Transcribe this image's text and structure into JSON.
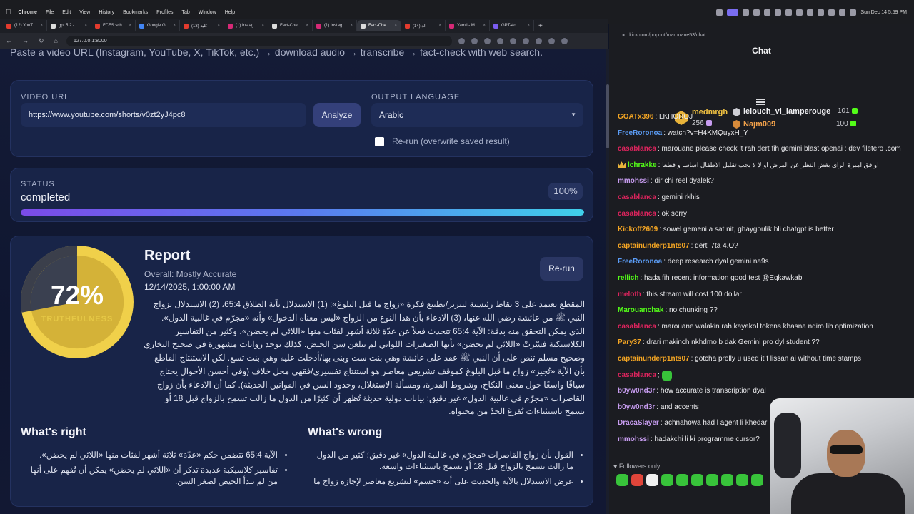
{
  "menubar": {
    "app": "Chrome",
    "items": [
      "File",
      "Edit",
      "View",
      "History",
      "Bookmarks",
      "Profiles",
      "Tab",
      "Window",
      "Help"
    ],
    "clock": "Sun Dec 14  5:59 PM"
  },
  "tabs": [
    {
      "title": "(12) YouT",
      "color": "#e33b2e",
      "active": false
    },
    {
      "title": "gpt 5.2 -",
      "color": "#dcdcdc",
      "active": false
    },
    {
      "title": "FCFS sch",
      "color": "#e33b2e",
      "active": false
    },
    {
      "title": "Google G",
      "color": "#4285f4",
      "active": false
    },
    {
      "title": "(13) كلية",
      "color": "#e33b2e",
      "active": false
    },
    {
      "title": "(1) Instag",
      "color": "#d62976",
      "active": false
    },
    {
      "title": "Fact-Che",
      "color": "#dcdcdc",
      "active": false
    },
    {
      "title": "(1) Instag",
      "color": "#d62976",
      "active": false
    },
    {
      "title": "Fact-Che",
      "color": "#dcdcdc",
      "active": true
    },
    {
      "title": "(14) الد",
      "color": "#e33b2e",
      "active": false
    },
    {
      "title": "Yamil - M",
      "color": "#d62976",
      "active": false
    },
    {
      "title": "GPT-4o",
      "color": "#7b5cf0",
      "active": false
    }
  ],
  "address": {
    "url": "127.0.0.1:8000"
  },
  "app": {
    "subtitle": "Paste a video URL (Instagram, YouTube, X, TikTok, etc.) → download audio → transcribe → fact-check with web search.",
    "video_url_label": "VIDEO URL",
    "video_url_value": "https://www.youtube.com/shorts/v0zt2yJ4pc8",
    "analyze_label": "Analyze",
    "output_language_label": "OUTPUT LANGUAGE",
    "output_language_value": "Arabic",
    "rerun_checkbox_label": "Re-run (overwrite saved result)",
    "status_label": "STATUS",
    "status_value": "completed",
    "progress_text": "100%",
    "progress": 1.0,
    "gauge_text": "72%",
    "gauge_value": 0.72,
    "gauge_sub": "TRUTHFULNESS",
    "report_title": "Report",
    "overall": "Overall: Mostly Accurate",
    "report_date": "12/14/2025, 1:00:00 AM",
    "rerun_button": "Re-run",
    "summary": "المقطع يعتمد على 3 نقاط رئيسية لتبرير/تطبيع فكرة «زواج ما قبل البلوغ»: (1) الاستدلال بآية الطلاق 65:4، (2) الاستدلال بزواج النبي ﷺ من عائشة رضي الله عنها، (3) الادعاء بأن هذا النوع من الزواج «ليس معناه الدخول» وأنه «مجرّم في غالبية الدول». الذي يمكن التحقق منه بدقة: الآية 65:4 تتحدث فعلاً عن عدّة ثلاثة أشهر لفئات منها «اللائي لم يحضن»، وكثير من التفاسير الكلاسيكية فسّرتْ «اللائي لم يحضن» بأنها الصغيرات اللواتي لم يبلغن سن الحيض. كذلك توجد روايات مشهورة في صحيح البخاري وصحيح مسلم تنص على أن النبي ﷺ عقد على عائشة وهي بنت ست وبنى بها/أدخلت عليه وهي بنت تسع. لكن الاستنتاج القاطع بأن الآية «تُجيز» زواج ما قبل البلوغ كموقف تشريعي معاصر هو استنتاج تفسيري/فقهي محل خلاف (وفي أحسن الأحوال يحتاج سياقًا واسعًا حول معنى النكاح، وشروط القدرة، ومسألة الاستغلال، وحدود السن في القوانين الحديثة). كما أن الادعاء بأن زواج القاصرات «مجرّم في غالبية الدول» غير دقيق: بيانات دولية حديثة تُظهر أن كثيرًا من الدول ما زالت تسمح بالزواج قبل 18 أو تسمح باستثناءات تُفرغ الحدّ من محتواه.",
    "right_title": "What's right",
    "right_items": [
      "الآية 65:4 تتضمن حكم «عدّة» ثلاثة أشهر لفئات منها «اللائي لم يحضن».",
      "تفاسير كلاسيكية عديدة تذكر أن «اللائي لم يحضن» يمكن أن تُفهم على أنها من لم تبدأ الحيض لصغر السن."
    ],
    "wrong_title": "What's wrong",
    "wrong_items": [
      "القول بأن زواج القاصرات «مجرّم في غالبية الدول» غير دقيق؛ كثير من الدول ما زالت تسمح بالزواج قبل 18 أو تسمح باستثناءات واسعة.",
      "عرض الاستدلال بالآية والحديث على أنه «حسم» لتشريع معاصر لإجازة زواج ما"
    ]
  },
  "chat": {
    "url": "kick.com/popout/marouane53/chat",
    "title": "Chat",
    "pinned": {
      "user1": "medmrgh",
      "count1": "256",
      "user2": "lelouch_vi_lamperouge",
      "count2": "101",
      "user3": "Najm009",
      "count3": "100"
    },
    "messages": [
      {
        "user": "GOATx396",
        "color": "#f5a623",
        "text": "LKHOROJ"
      },
      {
        "user": "FreeRoronoa",
        "color": "#5b9cf5",
        "text": "watch?v=H4KMQuyxH_Y"
      },
      {
        "user": "casablanca",
        "color": "#e0245e",
        "text": "marouane please check it rah dert fih gemini blast openai : dev filetero .com"
      },
      {
        "user": "lchrakke",
        "color": "#53fc18",
        "crown": true,
        "text": "اوافق اميرة الراي بغض النظر عن المرض او لا لا يجب تقليل الاطفال اساسا و قطعا"
      },
      {
        "user": "mmohssi",
        "color": "#c79cf0",
        "text": "dir chi reel dyalek?"
      },
      {
        "user": "casablanca",
        "color": "#e0245e",
        "text": "gemini rkhis"
      },
      {
        "user": "casablanca",
        "color": "#e0245e",
        "text": "ok sorry"
      },
      {
        "user": "Kickoff2609",
        "color": "#f5a623",
        "text": "sowel gemeni a sat nit, ghaygoulik bli chatgpt is better"
      },
      {
        "user": "captainunderp1nts07",
        "color": "#f5a623",
        "text": "derti 7ta 4.O?"
      },
      {
        "user": "FreeRoronoa",
        "color": "#5b9cf5",
        "text": "deep research dyal gemini na9s"
      },
      {
        "user": "rellich",
        "color": "#53fc18",
        "text": "hada fih recent information good test @Eqkawkab"
      },
      {
        "user": "meloth",
        "color": "#e0245e",
        "text": "this stream will cost 100 dollar"
      },
      {
        "user": "Marouanchak",
        "color": "#53fc18",
        "text": "no chunking ??"
      },
      {
        "user": "casablanca",
        "color": "#e0245e",
        "text": "marouane walakin rah kayakol tokens khasna ndiro lih optimization"
      },
      {
        "user": "Pary37",
        "color": "#f5a623",
        "text": "drari makinch nkhdmo b dak Gemini pro dyl student ??"
      },
      {
        "user": "captainunderp1nts07",
        "color": "#f5a623",
        "text": "gotcha prolly u used it f lissan ai without time stamps"
      },
      {
        "user": "casablanca",
        "color": "#e0245e",
        "emote": true,
        "text": ""
      },
      {
        "user": "b0yw0nd3r",
        "color": "#c79cf0",
        "text": "how accurate is transcription dyal"
      },
      {
        "user": "b0yw0nd3r",
        "color": "#c79cf0",
        "text": "and accents"
      },
      {
        "user": "DracaSlayer",
        "color": "#c79cf0",
        "text": "achnahowa had l agent li khedar"
      },
      {
        "user": "mmohssi",
        "color": "#c79cf0",
        "text": "hadakchi li ki programme cursor?"
      }
    ],
    "followers_only": "Followers only",
    "emotes": [
      "#38c33a",
      "#e0453a",
      "#f0f0f0",
      "#38c33a",
      "#38c33a",
      "#38c33a",
      "#38c33a",
      "#38c33a",
      "#38c33a",
      "#38c33a"
    ]
  }
}
